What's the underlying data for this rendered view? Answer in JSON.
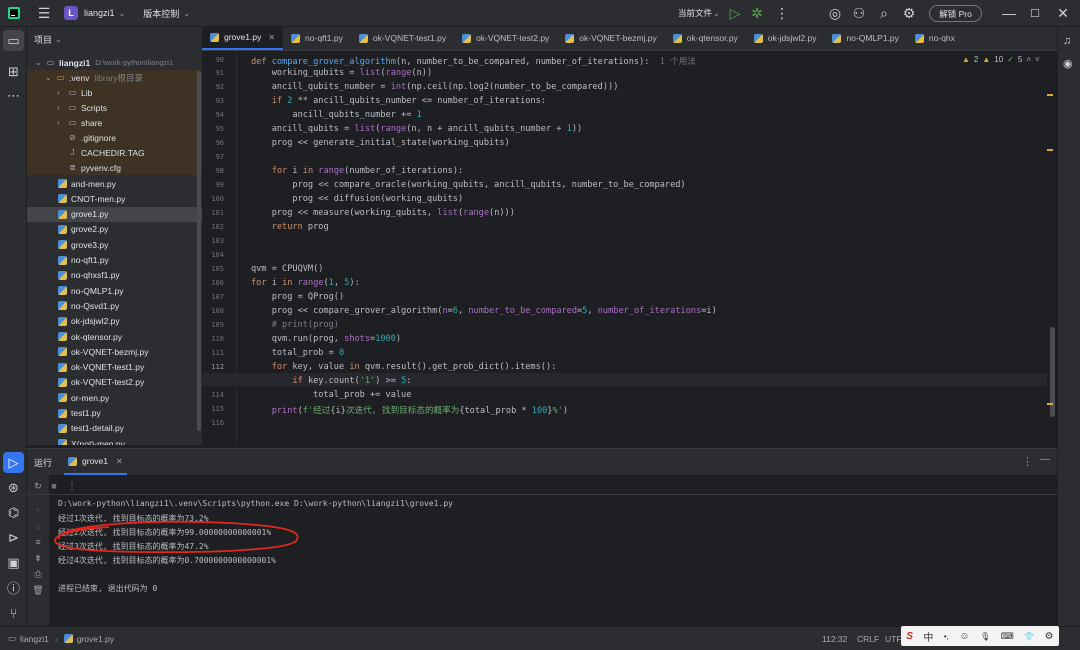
{
  "titlebar": {
    "project_badge": "L",
    "project_name": "liangzi1",
    "vcs_label": "版本控制",
    "run_config": "当前文件",
    "pro_button": "解锁 Pro"
  },
  "project_panel": {
    "title": "项目",
    "root_name": "liangzi1",
    "root_path": "D:\\work-python\\liangzi1",
    "venv_name": ".venv",
    "venv_note": "library根目录",
    "venv_children": [
      "Lib",
      "Scripts",
      "share"
    ],
    "venv_files": [
      ".gitignore",
      "CACHEDIR.TAG",
      "pyvenv.cfg"
    ],
    "files": [
      "and-men.py",
      "CNOT-men.py",
      "grove1.py",
      "grove2.py",
      "grove3.py",
      "no-qft1.py",
      "no-qhxsf1.py",
      "no-QMLP1.py",
      "no-Qsvd1.py",
      "ok-jdsjwl2.py",
      "ok-qtensor.py",
      "ok-VQNET-bezmj.py",
      "ok-VQNET-test1.py",
      "ok-VQNET-test2.py",
      "or-men.py",
      "test1.py",
      "test1-detail.py",
      "X(not)-men.py"
    ],
    "selected_file": "grove1.py"
  },
  "editor": {
    "tabs": [
      "grove1.py",
      "no-qft1.py",
      "ok-VQNET-test1.py",
      "ok-VQNET-test2.py",
      "ok-VQNET-bezmj.py",
      "ok-qtensor.py",
      "ok-jdsjwl2.py",
      "no-QMLP1.py",
      "no-qhx"
    ],
    "active_tab": "grove1.py",
    "inspection": {
      "warnings": "2",
      "weak_warnings": "10",
      "ok": "5"
    },
    "usage_hint": "1 个用法",
    "line_numbers": [
      "90",
      "91",
      "92",
      "93",
      "94",
      "95",
      "96",
      "97",
      "98",
      "99",
      "100",
      "101",
      "102",
      "103",
      "104",
      "105",
      "106",
      "107",
      "108",
      "109",
      "110",
      "111",
      "112",
      "113",
      "114",
      "115",
      "116"
    ],
    "current_line": "112"
  },
  "run_panel": {
    "title": "运行",
    "tab": "grove1",
    "output": [
      "D:\\work-python\\liangzi1\\.venv\\Scripts\\python.exe D:\\work-python\\liangzi1\\grove1.py",
      "经过1次迭代, 找到目标态的概率为73.2%",
      "经过2次迭代, 找到目标态的概率为99.00000000000001%",
      "经过3次迭代, 找到目标态的概率为47.2%",
      "经过4次迭代, 找到目标态的概率为0.7000000000000001%",
      "",
      "进程已结束, 退出代码为 0"
    ]
  },
  "statusbar": {
    "project": "liangzi1",
    "file": "grove1.py",
    "position": "112:32",
    "line_ending": "CRLF",
    "encoding": "UTF"
  },
  "ime": {
    "logo": "S",
    "lang": "中",
    "punct": "•,",
    "items": [
      "☺",
      "🎙",
      "⌨",
      "👕",
      "⚙"
    ]
  },
  "colors": {
    "accent": "#3574f0",
    "annotation_red": "#e0281e"
  }
}
